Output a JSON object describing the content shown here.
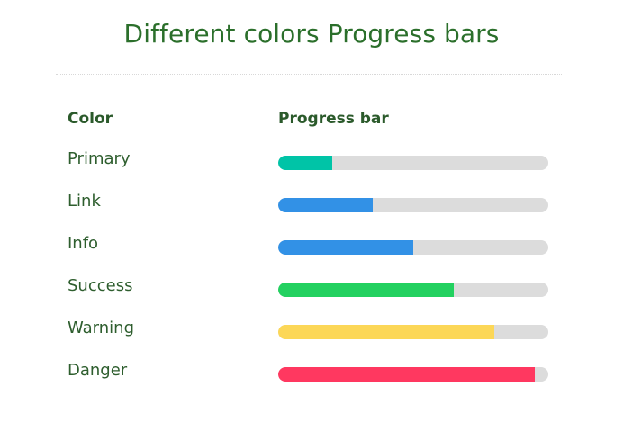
{
  "title": "Different colors Progress bars",
  "table": {
    "headers": {
      "color": "Color",
      "progress": "Progress bar"
    },
    "rows": [
      {
        "label": "Primary",
        "value": 0.2,
        "color": "#00c4a7"
      },
      {
        "label": "Link",
        "value": 0.35,
        "color": "#3291e6"
      },
      {
        "label": "Info",
        "value": 0.5,
        "color": "#3291e6"
      },
      {
        "label": "Success",
        "value": 0.65,
        "color": "#23d160"
      },
      {
        "label": "Warning",
        "value": 0.8,
        "color": "#fcd757"
      },
      {
        "label": "Danger",
        "value": 0.95,
        "color": "#ff3860"
      }
    ]
  },
  "colors": {
    "title": "#2b6f2b",
    "track": "#dcdcdc"
  }
}
